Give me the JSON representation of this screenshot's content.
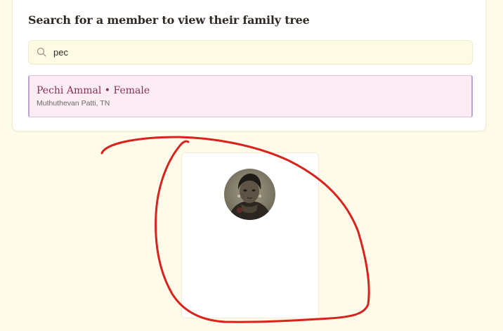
{
  "search_panel": {
    "heading": "Search for a member to view their family tree",
    "query": "pec"
  },
  "results": [
    {
      "name_line": "Pechi Ammal • Female",
      "place": "Muthuthevan Patti, TN"
    }
  ],
  "member_card": {
    "avatar": "member-portrait-photo"
  },
  "colors": {
    "page_background": "#fefbea",
    "result_background": "#fcedf4",
    "result_name_text": "#8a2f56",
    "annotation_stroke": "#d9221c"
  },
  "icons": {
    "search": "search-icon"
  }
}
